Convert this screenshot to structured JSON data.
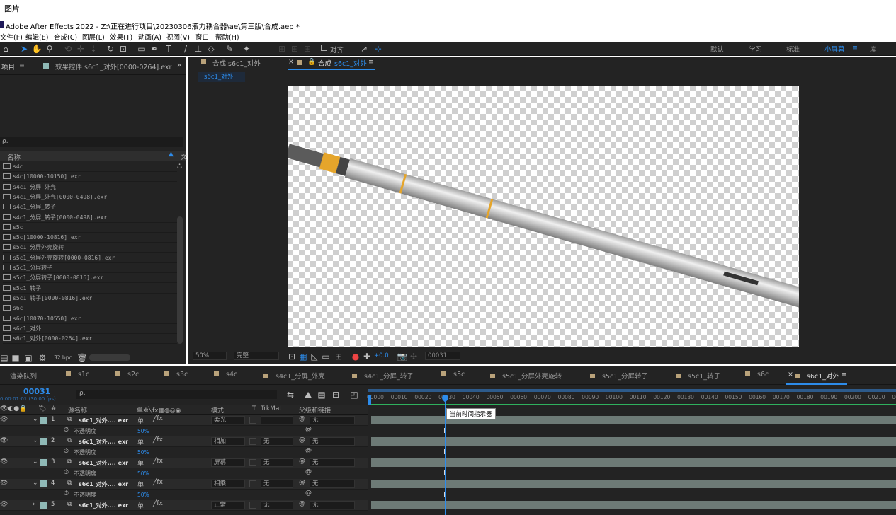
{
  "caption": "图片",
  "window": {
    "title": "Adobe After Effects 2022 - Z:\\正在进行项目\\20230306液力耦合器\\ae\\第三版\\合成.aep *"
  },
  "menu": [
    "文件(F)",
    "编辑(E)",
    "合成(C)",
    "图层(L)",
    "效果(T)",
    "动画(A)",
    "视图(V)",
    "窗口",
    "帮助(H)"
  ],
  "toolbar": {
    "align_label": "对齐",
    "workspaces": [
      "默认",
      "学习",
      "标准",
      "小屏幕",
      "库"
    ],
    "active_workspace": "小屏幕"
  },
  "project": {
    "tab_project": "项目",
    "tab_effects": "效果控件 s6c1_对外[0000-0264].exr",
    "search_placeholder": "ρ.",
    "column_name": "名称",
    "files": [
      "s4c",
      "s4c[10000-10150].exr",
      "s4c1_分屏_外壳",
      "s4c1_分屏_外壳[0000-0498].exr",
      "s4c1_分屏_转子",
      "s4c1_分屏_转子[0000-0498].exr",
      "s5c",
      "s5c[10000-10816].exr",
      "s5c1_分屏外壳旋转",
      "s5c1_分屏外壳旋转[0000-0816].exr",
      "s5c1_分屏转子",
      "s5c1_分屏转子[0000-0816].exr",
      "s5c1_转子",
      "s5c1_转子[0000-0816].exr",
      "s6c",
      "s6c[10070-10550].exr",
      "s6c1_对外",
      "s6c1_对外[0000-0264].exr"
    ],
    "bpc": "32 bpc"
  },
  "composition": {
    "tab_inactive": "合成 s6c1_对外",
    "tab_active_prefix": "合成",
    "tab_active_name": "s6c1_对外",
    "breadcrumb": "s6c1_对外",
    "zoom": "50%",
    "quality": "完整",
    "exposure": "+0.0",
    "frame": "00031"
  },
  "timeline": {
    "tabs": [
      "渲染队列",
      "s1c",
      "s2c",
      "s3c",
      "s4c",
      "s4c1_分屏_外壳",
      "s4c1_分屏_转子",
      "s5c",
      "s5c1_分屏外壳旋转",
      "s5c1_分屏转子",
      "s5c1_转子",
      "s6c",
      "s6c1_对外"
    ],
    "current_frame": "00031",
    "timecode": "0:00:01:01 (30.00 fps)",
    "columns": {
      "source": "源名称",
      "mode": "模式",
      "t": "T",
      "trkmat": "TrkMat",
      "parent": "父级和链接"
    },
    "ticks": [
      "00000",
      "00010",
      "00020",
      "00030",
      "00040",
      "00050",
      "00060",
      "00070",
      "00080",
      "00090",
      "00100",
      "00110",
      "00120",
      "00130",
      "00140",
      "00150",
      "00160",
      "00170",
      "00180",
      "00190",
      "00200",
      "00210",
      "002"
    ],
    "tooltip": "当前时间指示器",
    "layers": [
      {
        "num": "1",
        "name": "s6c1_对外.... exr",
        "mode": "柔光",
        "trkmat": "",
        "parent": "无",
        "prop": "不透明度",
        "value": "50%"
      },
      {
        "num": "2",
        "name": "s6c1_对外.... exr",
        "mode": "相加",
        "trkmat": "无",
        "parent": "无",
        "prop": "不透明度",
        "value": "50%"
      },
      {
        "num": "3",
        "name": "s6c1_对外.... exr",
        "mode": "屏幕",
        "trkmat": "无",
        "parent": "无",
        "prop": "不透明度",
        "value": "50%"
      },
      {
        "num": "4",
        "name": "s6c1_对外.... exr",
        "mode": "相乘",
        "trkmat": "无",
        "parent": "无",
        "prop": "不透明度",
        "value": "50%"
      },
      {
        "num": "5",
        "name": "s6c1_对外.... exr",
        "mode": "正常",
        "trkmat": "无",
        "parent": "无"
      }
    ]
  },
  "colors": {
    "accent": "#2d8ceb",
    "panel": "#232323",
    "label_color": "#8fb9b6",
    "track_bar": "#6d7a76"
  }
}
